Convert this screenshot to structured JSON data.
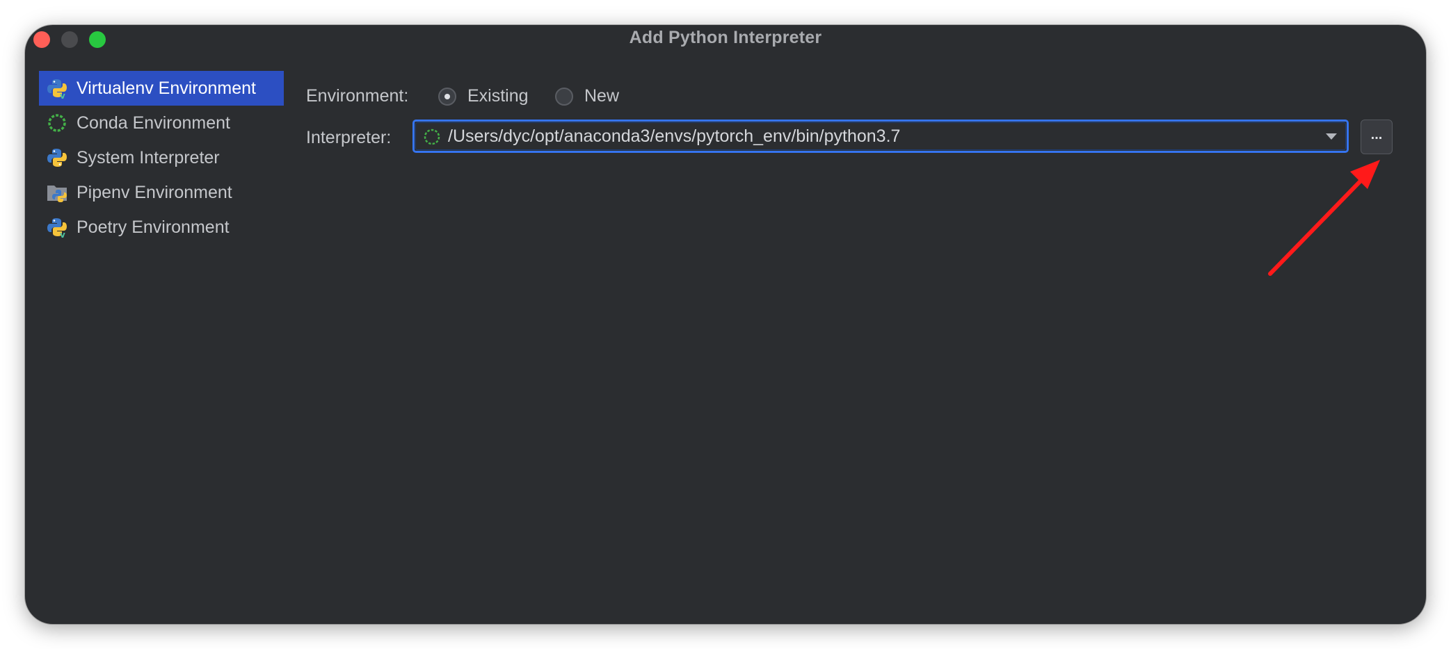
{
  "window": {
    "title": "Add Python Interpreter"
  },
  "sidebar": {
    "items": [
      {
        "label": "Virtualenv Environment",
        "icon": "python-virtualenv-icon",
        "selected": true
      },
      {
        "label": "Conda Environment",
        "icon": "conda-icon",
        "selected": false
      },
      {
        "label": "System Interpreter",
        "icon": "python-icon",
        "selected": false
      },
      {
        "label": "Pipenv Environment",
        "icon": "pipenv-icon",
        "selected": false
      },
      {
        "label": "Poetry Environment",
        "icon": "poetry-icon",
        "selected": false
      }
    ]
  },
  "form": {
    "environment_label": "Environment:",
    "environment_options": [
      {
        "label": "Existing",
        "selected": true
      },
      {
        "label": "New",
        "selected": false
      }
    ],
    "interpreter_label": "Interpreter:",
    "interpreter_value": "/Users/dyc/opt/anaconda3/envs/pytorch_env/bin/python3.7",
    "browse_label": "..."
  },
  "annotation": {
    "arrow_color": "#ff1a1a"
  },
  "colors": {
    "window_bg": "#2b2d30",
    "selection": "#2c4fc2",
    "focus_border": "#3574f0",
    "close": "#ff5f57",
    "maximize": "#28c840"
  }
}
